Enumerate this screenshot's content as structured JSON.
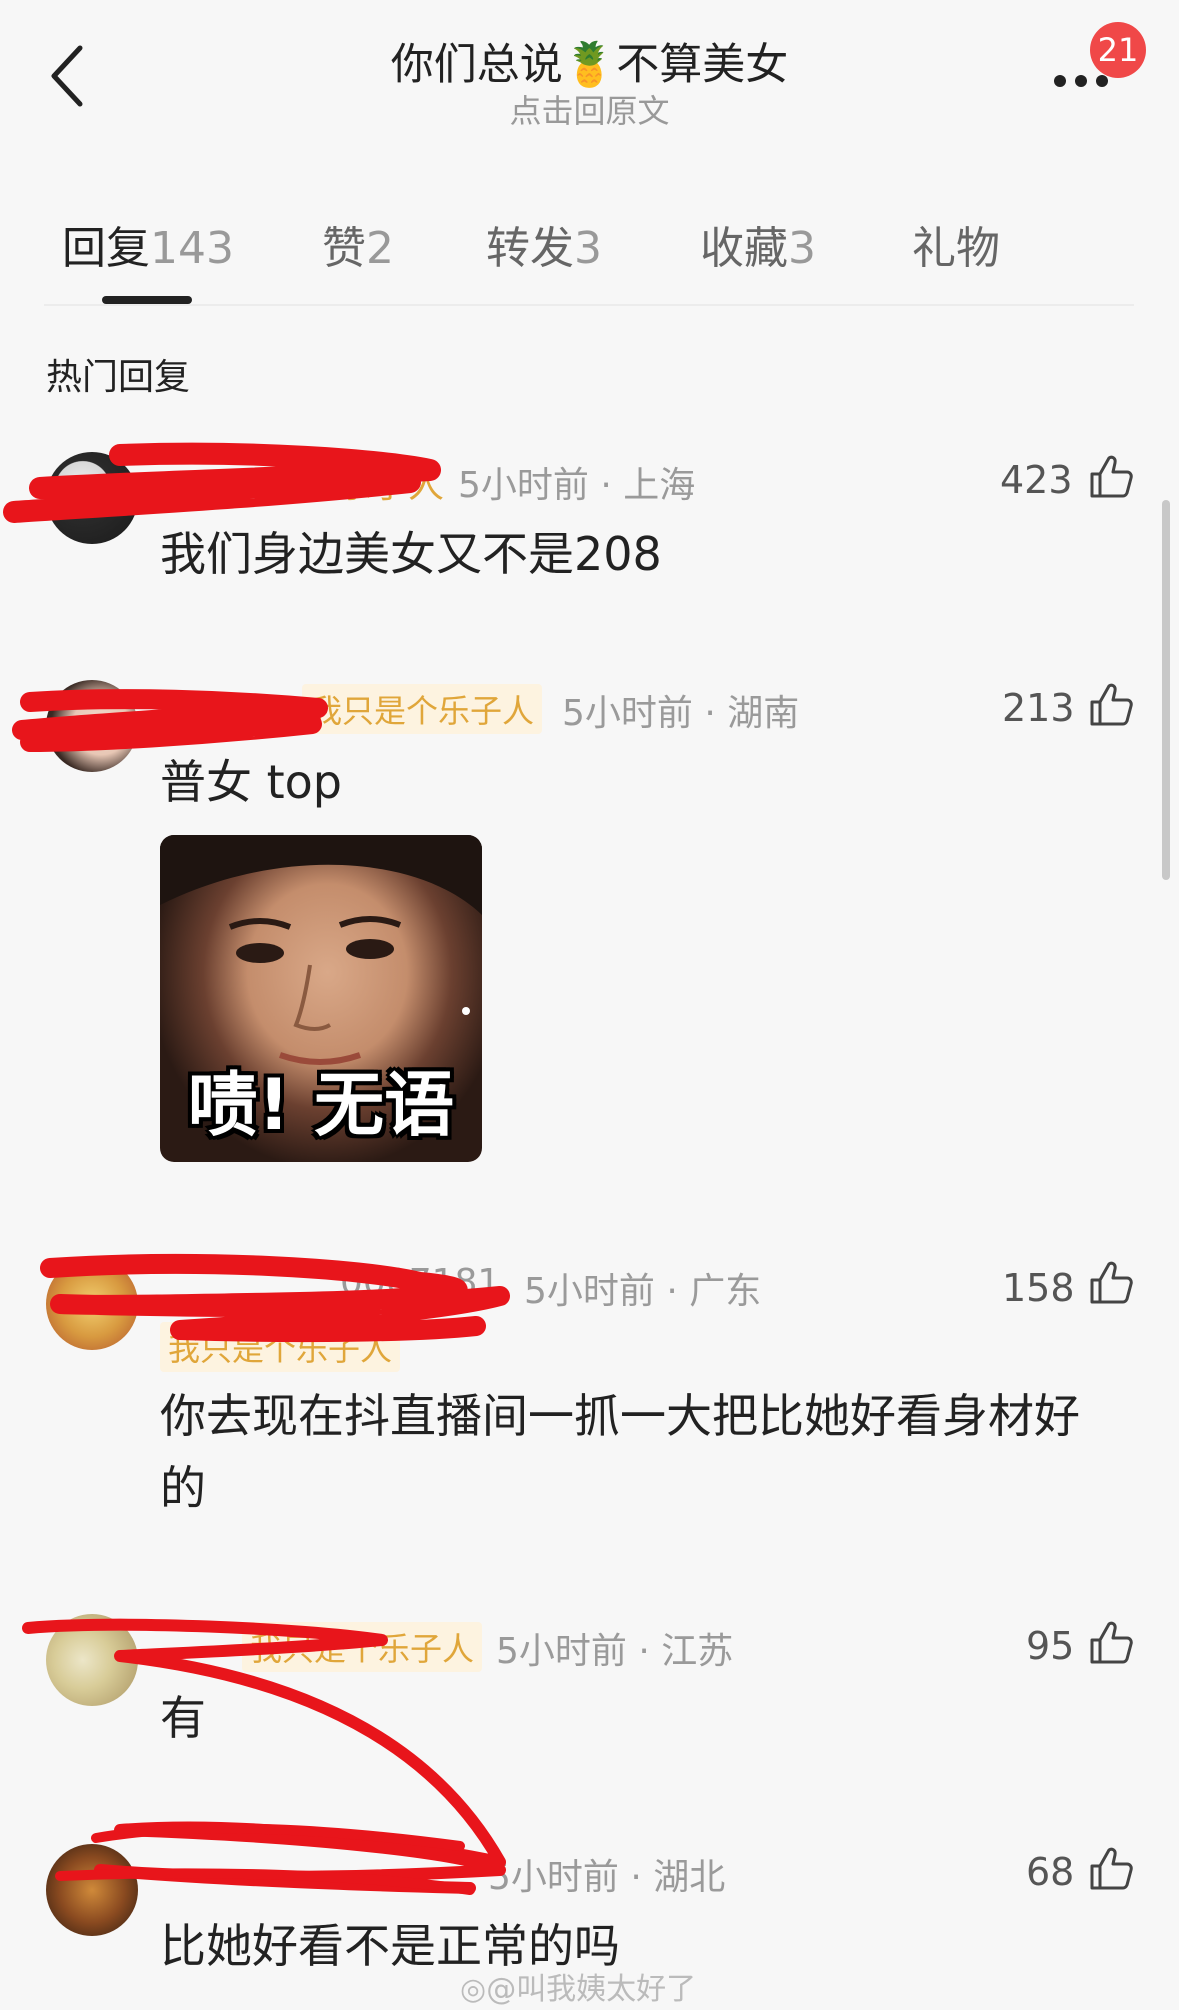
{
  "header": {
    "title_part1": "你们总说",
    "title_emoji": "🍍",
    "title_part2": "不算美女",
    "subtitle": "点击回原文",
    "badge_count": "21"
  },
  "tabs": [
    {
      "label": "回复",
      "count": "143",
      "active": true
    },
    {
      "label": "赞",
      "count": "2",
      "active": false
    },
    {
      "label": "转发",
      "count": "3",
      "active": false
    },
    {
      "label": "收藏",
      "count": "3",
      "active": false
    },
    {
      "label": "礼物",
      "count": "",
      "active": false
    }
  ],
  "section_title": "热门回复",
  "comments": [
    {
      "username_partial": "个乐子人",
      "meta": "5小时前 · 上海",
      "likes": "423",
      "text": "我们身边美女又不是208"
    },
    {
      "tag": "我只是个乐子人",
      "meta": "5小时前 · 湖南",
      "likes": "213",
      "text": "普女 top",
      "sticker_caption": "啧! 无语"
    },
    {
      "username_partial": "0007181",
      "tag": "我只是个乐子人",
      "meta": "5小时前 · 广东",
      "likes": "158",
      "text_line1": "你去现在抖直播间一抓一大把比她好看身材好",
      "text_line2": "的"
    },
    {
      "tag": "我只是个乐子人",
      "meta": "5小时前 · 江苏",
      "likes": "95",
      "text": "有"
    },
    {
      "meta": "5小时前 · 湖北",
      "likes": "68",
      "text": "比她好看不是正常的吗"
    }
  ],
  "watermark": "@叫我姨太好了",
  "colors": {
    "accent_tag": "#e0a63a",
    "badge": "#f04848",
    "redaction": "#e8151b"
  },
  "icons": [
    "back-arrow-icon",
    "more-dots-icon",
    "thumbs-up-icon",
    "weibo-icon"
  ]
}
